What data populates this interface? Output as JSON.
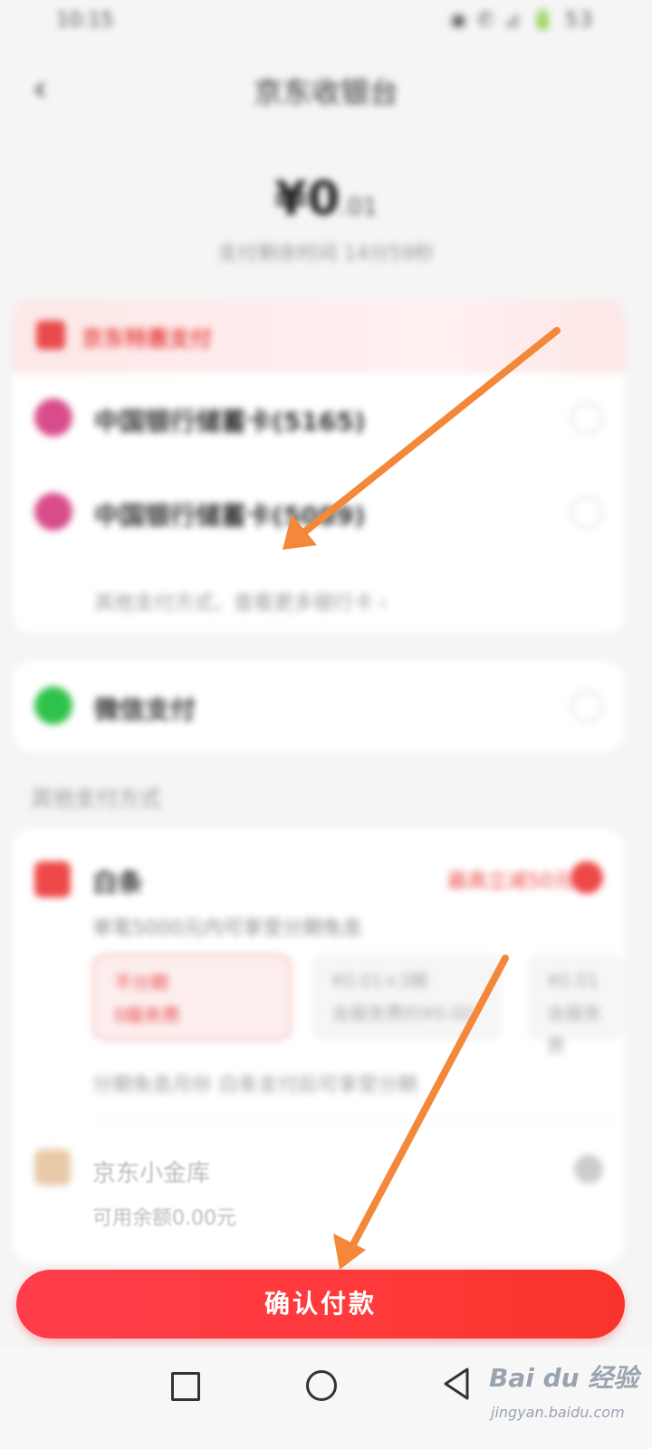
{
  "status_bar": {
    "time": "10:15",
    "icons": "◉ ✆ ⊿ 🔋 53"
  },
  "header": {
    "title": "京东收银台"
  },
  "amount": {
    "value": "¥0",
    "decimal": ".01",
    "subtitle": "支付剩余时间 14分59秒"
  },
  "promo": {
    "label": "京东特惠支付"
  },
  "pay_options": [
    {
      "label": "中国银行储蓄卡(5165)",
      "icon": "bank-icon"
    },
    {
      "label": "中国银行储蓄卡(5089)",
      "icon": "bank-icon"
    }
  ],
  "more_cards": "其他支付方式，查看更多银行卡 ›",
  "wechat": {
    "label": "微信支付",
    "icon": "wechat-icon"
  },
  "section_label": "其他支付方式",
  "baitiao": {
    "label": "白条",
    "promo": "最高立减50元 ›",
    "desc": "单笔5000元内可享受分期免息",
    "plans": [
      {
        "line1": "不分期",
        "line2": "0服务费"
      },
      {
        "line1": "¥0.01×3期",
        "line2": "含服务费约¥0.00"
      },
      {
        "line1": "¥0.01",
        "line2": "含服务费"
      }
    ],
    "note": "分期免息月份 白条支付后可享受分期"
  },
  "vault": {
    "label": "京东小金库",
    "balance": "可用余额0.00元"
  },
  "confirm_label": "确认付款",
  "watermark": {
    "main": "Bai du 经验",
    "sub": "jingyan.baidu.com"
  },
  "colors": {
    "accent": "#ff3c4b",
    "arrow": "#f4883a",
    "wechat": "#2fc24a"
  }
}
